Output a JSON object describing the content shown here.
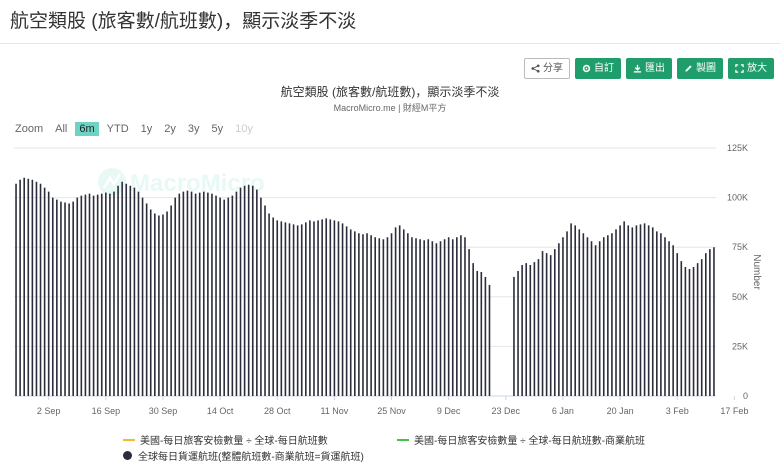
{
  "page": {
    "title": "航空類股 (旅客數/航班數)，顯示淡季不淡"
  },
  "toolbar": {
    "share": "分享",
    "customize": "自訂",
    "export": "匯出",
    "draw": "製圖",
    "enlarge": "放大"
  },
  "chart": {
    "title": "航空類股 (旅客數/航班數)，顯示淡季不淡",
    "subtitle": "MacroMicro.me | 財經M平方",
    "watermark": "MacroMicro"
  },
  "zoom": {
    "label": "Zoom",
    "options": [
      "All",
      "6m",
      "YTD",
      "1y",
      "2y",
      "3y",
      "5y",
      "10y"
    ],
    "active": "6m",
    "disabled": [
      "10y"
    ]
  },
  "legend": [
    {
      "label": "美國-每日旅客安檢數量 ÷ 全球-每日航班數",
      "color": "#f5b82e",
      "style": "line"
    },
    {
      "label": "美國-每日旅客安檢數量 ÷ 全球-每日航班數-商業航班",
      "color": "#4cbf4c",
      "style": "line"
    },
    {
      "label": "全球每日貨運航班(整體航班數-商業航班=貨運航班)",
      "color": "#2b2d3a",
      "style": "dot"
    }
  ],
  "chart_data": {
    "type": "bar",
    "title": "航空類股 (旅客數/航班數)，顯示淡季不淡",
    "ylabel": "Number",
    "ylim": [
      0,
      125000
    ],
    "y_ticks": [
      0,
      25000,
      50000,
      75000,
      100000,
      125000
    ],
    "y_tick_labels": [
      "0",
      "25K",
      "50K",
      "75K",
      "100K",
      "125K"
    ],
    "x_tick_labels": [
      "2 Sep",
      "16 Sep",
      "30 Sep",
      "14 Oct",
      "28 Oct",
      "11 Nov",
      "25 Nov",
      "9 Dec",
      "23 Dec",
      "6 Jan",
      "20 Jan",
      "3 Feb",
      "17 Feb"
    ],
    "grid": true,
    "series": [
      {
        "name": "全球每日貨運航班(整體航班數-商業航班=貨運航班)",
        "start_date": "2019-08-25",
        "values": [
          107000,
          109000,
          110000,
          109500,
          109000,
          108000,
          107000,
          105000,
          103000,
          100000,
          99000,
          98000,
          97500,
          97000,
          98000,
          100000,
          101000,
          101500,
          102000,
          101000,
          101500,
          102000,
          102500,
          102000,
          103000,
          106000,
          108000,
          107000,
          106000,
          105000,
          103000,
          100000,
          97000,
          94000,
          92000,
          91000,
          91500,
          93000,
          96000,
          100000,
          102000,
          103000,
          103500,
          103000,
          102000,
          102500,
          103000,
          102500,
          102000,
          101000,
          100000,
          99000,
          100000,
          101000,
          103000,
          105000,
          106000,
          106500,
          106000,
          104000,
          100000,
          96000,
          92000,
          90000,
          88500,
          88000,
          87500,
          87000,
          86500,
          86000,
          86500,
          87500,
          88500,
          88000,
          88500,
          89000,
          89500,
          89000,
          88500,
          88000,
          87000,
          85500,
          84000,
          83000,
          82000,
          81500,
          82000,
          81000,
          80000,
          79500,
          79000,
          80000,
          82000,
          85000,
          86000,
          84000,
          82000,
          80000,
          79500,
          79000,
          78500,
          79000,
          78000,
          77000,
          78000,
          79000,
          80000,
          79000,
          80000,
          81000,
          80000,
          74000,
          67000,
          63000,
          62500,
          60000,
          56000,
          0,
          0,
          0,
          0,
          0,
          60000,
          63000,
          66000,
          67000,
          66000,
          67500,
          69000,
          73000,
          72000,
          71000,
          74000,
          77000,
          80000,
          83000,
          87000,
          86000,
          84000,
          82000,
          80000,
          78000,
          76000,
          78000,
          80000,
          81000,
          82000,
          84000,
          86000,
          88000,
          86000,
          85000,
          86000,
          86500,
          87000,
          86000,
          85000,
          83000,
          82000,
          80000,
          78000,
          76000,
          72000,
          68000,
          65000,
          64000,
          65000,
          67000,
          69000,
          72000,
          74000,
          75000
        ]
      },
      {
        "name": "美國-每日旅客安檢數量 ÷ 全球-每日航班數",
        "values": []
      },
      {
        "name": "美國-每日旅客安檢數量 ÷ 全球-每日航班數-商業航班",
        "values": []
      }
    ]
  }
}
